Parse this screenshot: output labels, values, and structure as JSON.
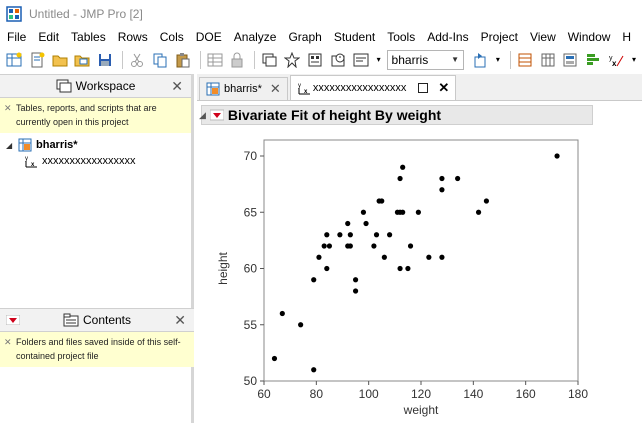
{
  "window": {
    "title": "Untitled - JMP Pro [2]"
  },
  "menubar": [
    "File",
    "Edit",
    "Tables",
    "Rows",
    "Cols",
    "DOE",
    "Analyze",
    "Graph",
    "Student",
    "Tools",
    "Add-Ins",
    "Project",
    "View",
    "Window",
    "H"
  ],
  "toolbar": {
    "selected_table": "bharris"
  },
  "workspace": {
    "header": "Workspace",
    "hint": "Tables, reports, and scripts that are currently open in this project",
    "tree": {
      "table_name": "bharris*",
      "report_name": "xxxxxxxxxxxxxxxxx"
    }
  },
  "contents": {
    "header": "Contents",
    "hint": "Folders and files saved inside of this self-contained project file"
  },
  "tabs": [
    {
      "label": "bharris*"
    },
    {
      "label": "xxxxxxxxxxxxxxxxx"
    }
  ],
  "report": {
    "title": "Bivariate Fit of height By weight"
  },
  "chart_data": {
    "type": "scatter",
    "xlabel": "weight",
    "ylabel": "height",
    "xlim": [
      60,
      180
    ],
    "ylim": [
      50,
      72
    ],
    "xticks": [
      60,
      80,
      100,
      120,
      140,
      160,
      180
    ],
    "yticks": [
      50,
      55,
      60,
      65,
      70
    ],
    "grid": false,
    "points": [
      [
        64,
        52
      ],
      [
        67,
        56
      ],
      [
        74,
        55
      ],
      [
        79,
        51
      ],
      [
        79,
        59
      ],
      [
        81,
        61
      ],
      [
        83,
        62
      ],
      [
        84,
        60
      ],
      [
        84,
        63
      ],
      [
        85,
        62
      ],
      [
        89,
        63
      ],
      [
        92,
        62
      ],
      [
        92,
        64
      ],
      [
        93,
        62
      ],
      [
        93,
        63
      ],
      [
        95,
        58
      ],
      [
        95,
        59
      ],
      [
        98,
        65
      ],
      [
        99,
        64
      ],
      [
        102,
        62
      ],
      [
        103,
        63
      ],
      [
        104,
        66
      ],
      [
        105,
        66
      ],
      [
        106,
        61
      ],
      [
        108,
        63
      ],
      [
        111,
        65
      ],
      [
        112,
        65
      ],
      [
        112,
        68
      ],
      [
        112,
        60
      ],
      [
        113,
        65
      ],
      [
        113,
        69
      ],
      [
        115,
        60
      ],
      [
        116,
        62
      ],
      [
        119,
        65
      ],
      [
        123,
        61
      ],
      [
        128,
        67
      ],
      [
        128,
        68
      ],
      [
        128,
        61
      ],
      [
        134,
        68
      ],
      [
        142,
        65
      ],
      [
        145,
        66
      ],
      [
        172,
        70
      ]
    ]
  }
}
